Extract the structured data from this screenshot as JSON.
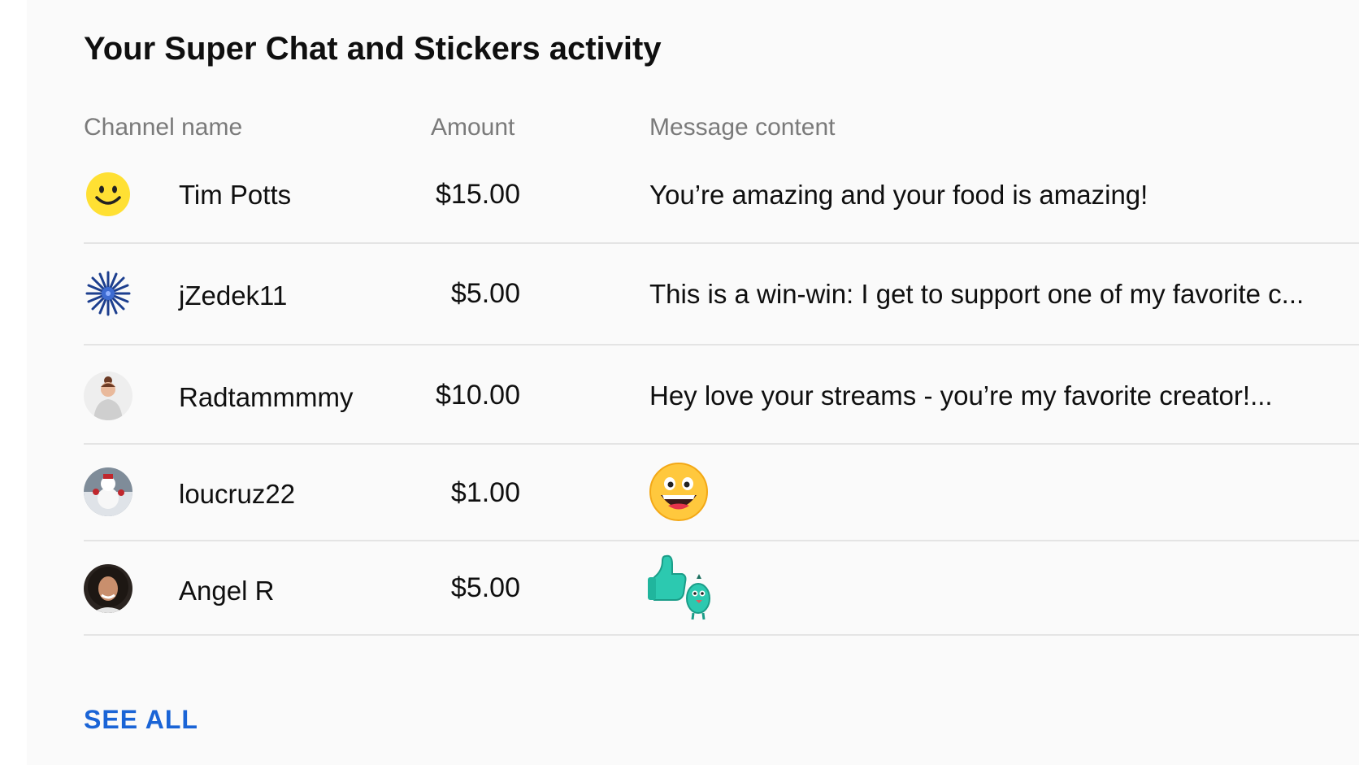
{
  "title": "Your Super Chat and Stickers activity",
  "columns": {
    "channel": "Channel name",
    "amount": "Amount",
    "message": "Message content"
  },
  "rows": [
    {
      "avatar": "smiley-face-icon",
      "name": "Tim Potts",
      "amount": "$15.00",
      "message": "You’re amazing and your food is amazing!"
    },
    {
      "avatar": "blue-burst-avatar",
      "name": "jZedek11",
      "amount": "$5.00",
      "message": "This is a win-win: I get to support one of my favorite c..."
    },
    {
      "avatar": "woman-photo-avatar",
      "name": "Radtammmmy",
      "amount": "$10.00",
      "message": "Hey love your streams - you’re my favorite creator!..."
    },
    {
      "avatar": "snowman-photo-avatar",
      "name": "loucruz22",
      "amount": "$1.00",
      "message": "",
      "sticker": "laughing-emoji-sticker"
    },
    {
      "avatar": "woman-curly-hair-avatar",
      "name": "Angel R",
      "amount": "$5.00",
      "message": "",
      "sticker": "thumbs-up-bird-sticker"
    }
  ],
  "see_all": "SEE ALL",
  "colors": {
    "link": "#1a64d6",
    "header_text": "#7a7a7a",
    "divider": "#e4e4e4"
  }
}
